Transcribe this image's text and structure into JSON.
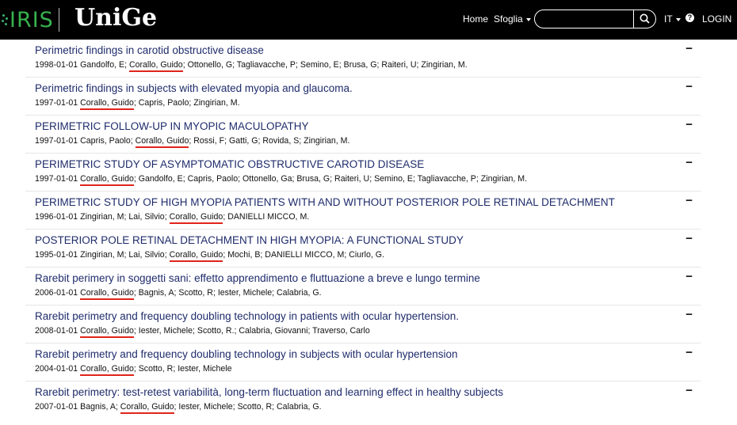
{
  "header": {
    "logo_iris": "IRIS",
    "logo_unige": "UniGe",
    "nav_home": "Home",
    "nav_sfoglia": "Sfoglia",
    "search_placeholder": "",
    "lang": "IT",
    "help_icon": "?",
    "login": "LOGIN",
    "brand_color": "#37b24d"
  },
  "items": [
    {
      "title": "Perimetric findings in carotid obstructive disease",
      "pre": "1998-01-01 Gandolfo, E; ",
      "hl": "Corallo, Guido",
      "post": "; Ottonello, G; Tagliavacche, P; Semino, E; Brusa, G; Raiteri, U; Zingirian, M.",
      "toggle": "−"
    },
    {
      "title": "Perimetric findings in subjects with elevated myopia and glaucoma.",
      "pre": "1997-01-01 ",
      "hl": "Corallo, Guido",
      "post": "; Capris, Paolo; Zingirian, M.",
      "toggle": "−"
    },
    {
      "title": "PERIMETRIC FOLLOW-UP IN MYOPIC MACULOPATHY",
      "pre": "1997-01-01 Capris, Paolo; ",
      "hl": "Corallo, Guido",
      "post": "; Rossi, F; Gatti, G; Rovida, S; Zingirian, M.",
      "toggle": "−"
    },
    {
      "title": "PERIMETRIC STUDY OF ASYMPTOMATIC OBSTRUCTIVE CAROTID DISEASE",
      "pre": "1997-01-01 ",
      "hl": "Corallo, Guido",
      "post": "; Gandolfo, E; Capris, Paolo; Ottonello, Ga; Brusa, G; Raiteri, U; Semino, E; Tagliavacche, P; Zingirian, M.",
      "toggle": "−"
    },
    {
      "title": "PERIMETRIC STUDY OF HIGH MYOPIA PATIENTS WITH AND WITHOUT POSTERIOR POLE RETINAL DETACHMENT",
      "pre": "1996-01-01 Zingirian, M; Lai, Silvio; ",
      "hl": "Corallo, Guido",
      "post": "; DANIELLI MICCO, M.",
      "toggle": "−"
    },
    {
      "title": "POSTERIOR POLE RETINAL DETACHMENT IN HIGH MYOPIA: A FUNCTIONAL STUDY",
      "pre": "1995-01-01 Zingirian, M; Lai, Silvio; ",
      "hl": "Corallo, Guido",
      "post": "; Mochi, B; DANIELLI MICCO, M; Ciurlo, G.",
      "toggle": "−"
    },
    {
      "title": "Rarebit perimery in soggetti sani: effetto apprendimento e fluttuazione a breve e lungo termine",
      "pre": "2006-01-01 ",
      "hl": "Corallo, Guido",
      "post": "; Bagnis, A; Scotto, R; Iester, Michele; Calabria, G.",
      "toggle": "−"
    },
    {
      "title": "Rarebit perimetry and frequency doubling technology in patients with ocular hypertension.",
      "pre": "2008-01-01 ",
      "hl": "Corallo, Guido",
      "post": "; Iester, Michele; Scotto, R.; Calabria, Giovanni; Traverso, Carlo",
      "toggle": "−"
    },
    {
      "title": "Rarebit perimetry and frequency doubling technology in subjects with ocular hypertension",
      "pre": "2004-01-01 ",
      "hl": "Corallo, Guido",
      "post": "; Scotto, R; Iester, Michele",
      "toggle": "−"
    },
    {
      "title": "Rarebit perimetry: test-retest variabilità, long-term fluctuation and learning effect in healthy subjects",
      "pre": "2007-01-01 Bagnis, A; ",
      "hl": "Corallo, Guido",
      "post": "; Iester, Michele; Scotto, R; Calabria, G.",
      "toggle": "−"
    }
  ]
}
